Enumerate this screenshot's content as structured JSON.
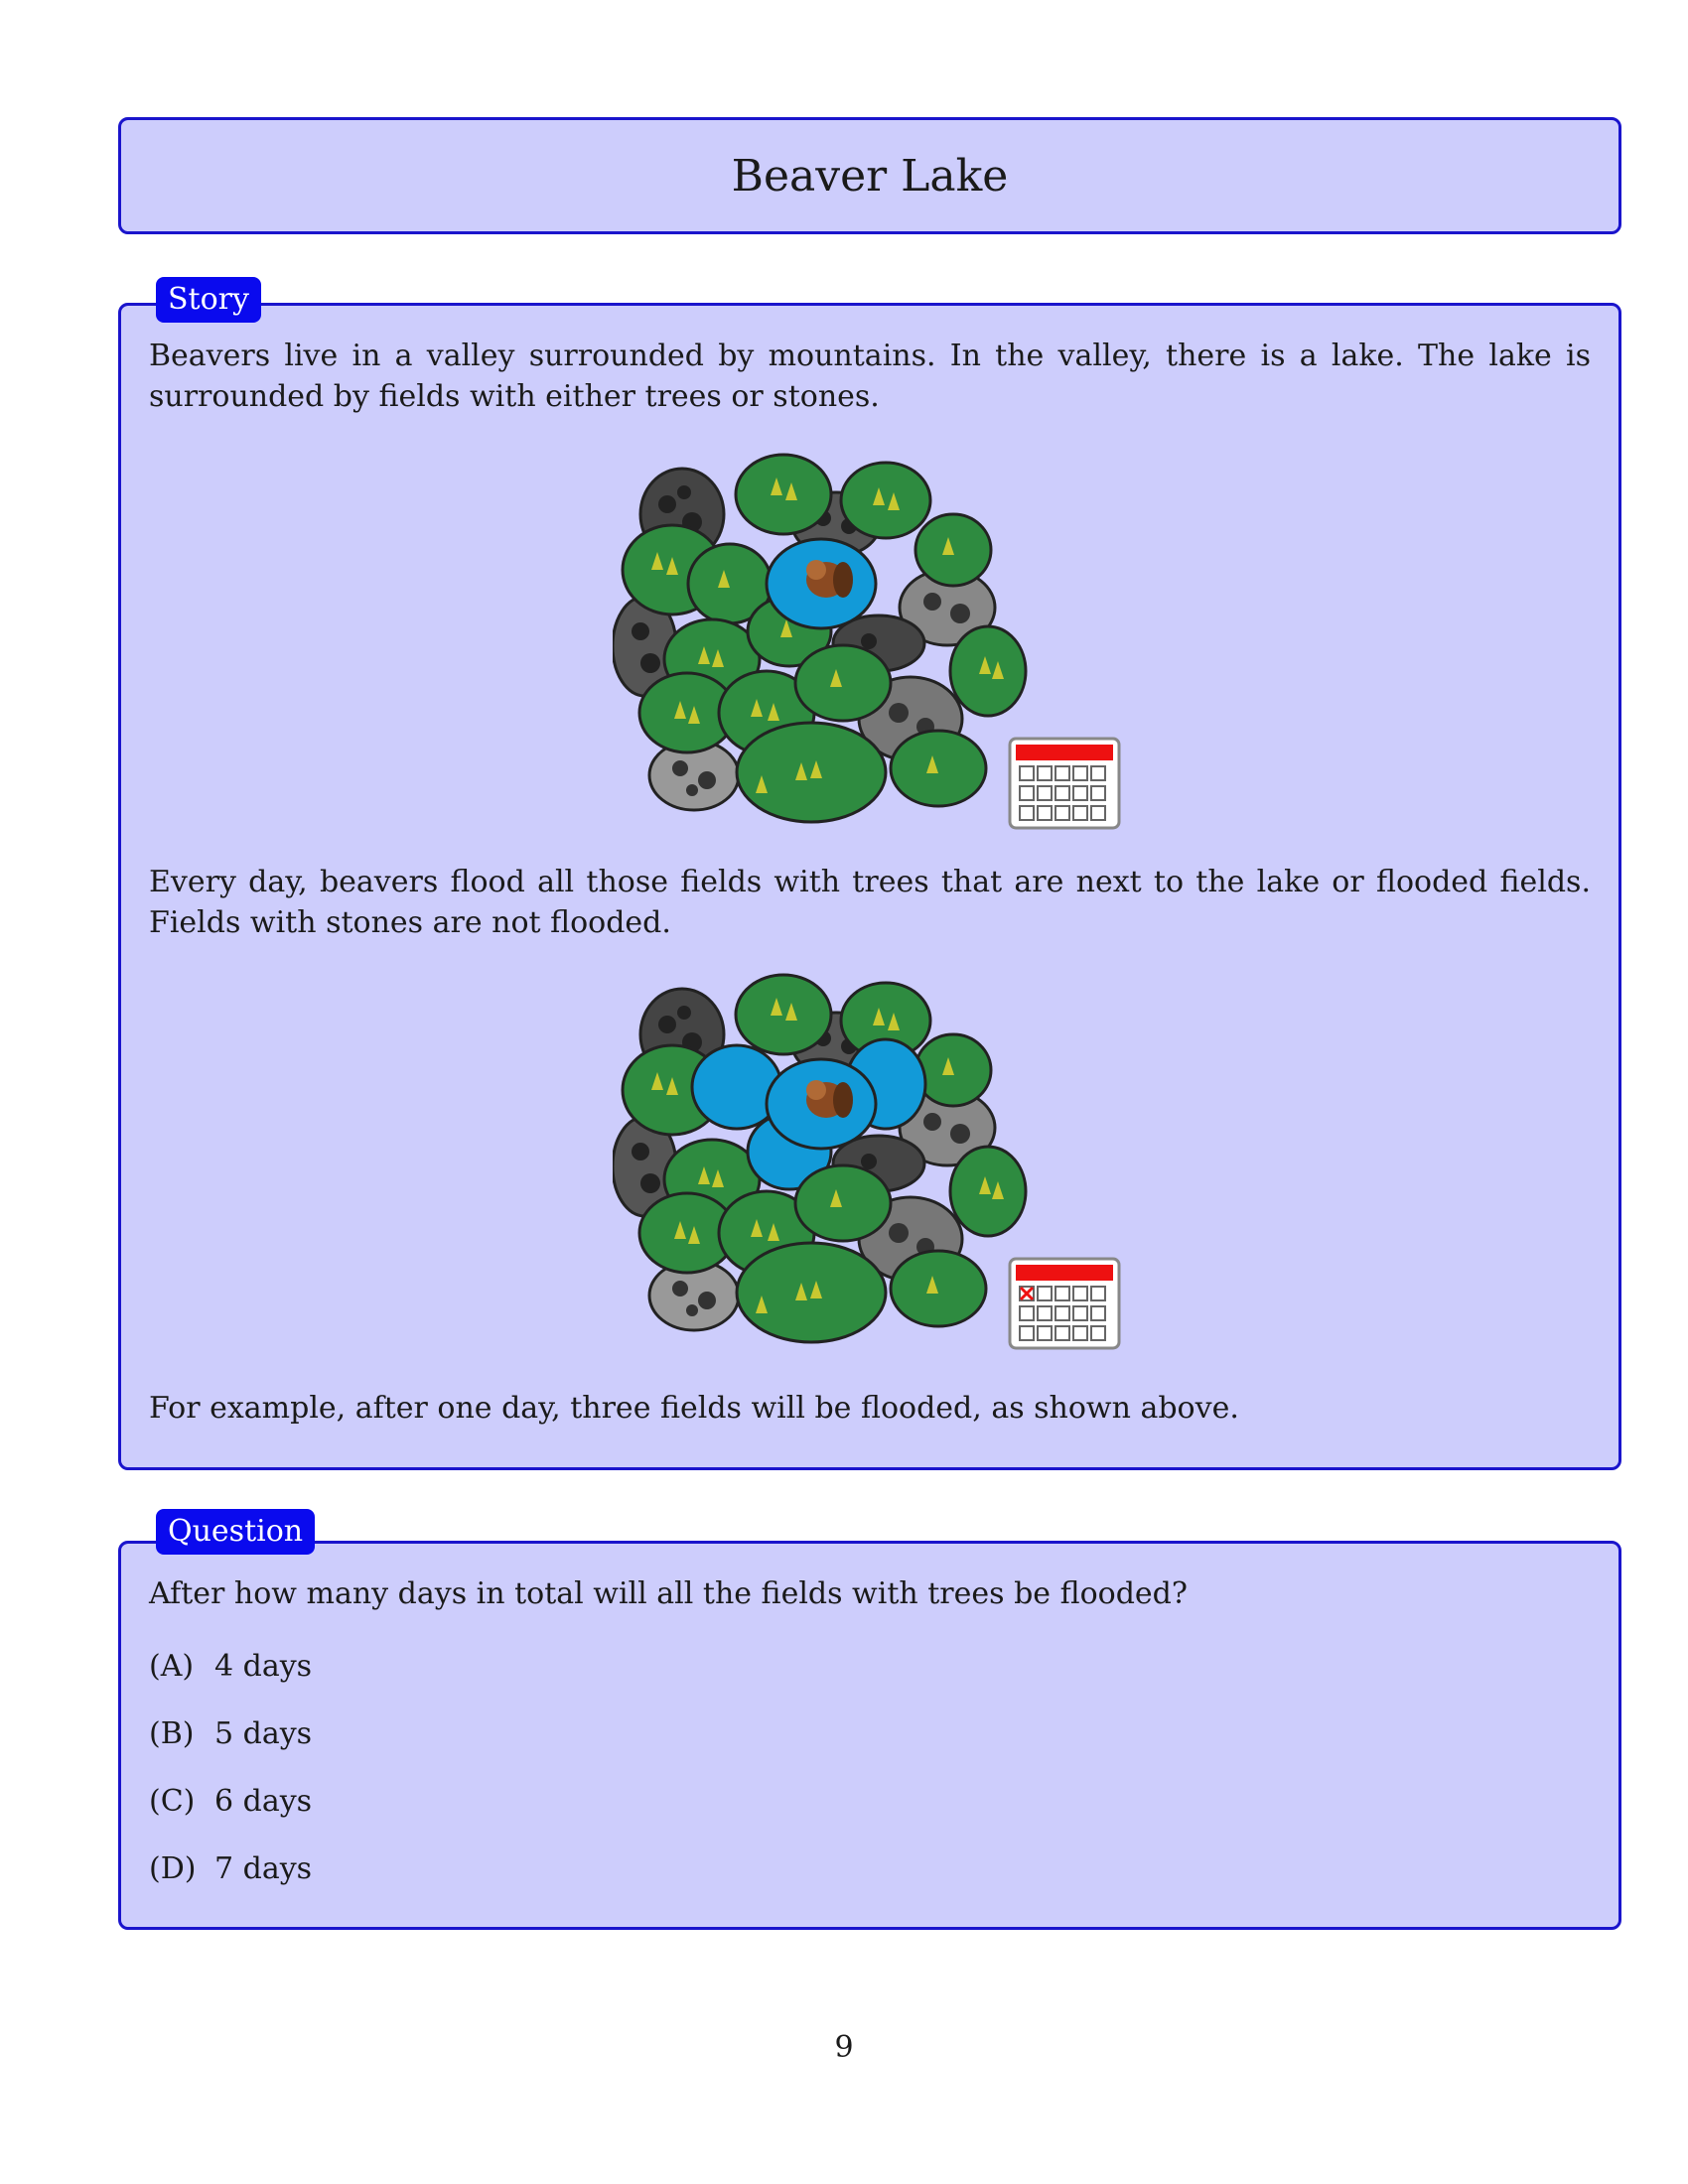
{
  "title": "Beaver Lake",
  "story": {
    "tag": "Story",
    "paragraph_1": "Beavers live in a valley surrounded by mountains. In the valley, there is a lake. The lake is surrounded by fields with either trees or stones.",
    "paragraph_2": "Every day, beavers flood all those fields with trees that are next to the lake or flooded fields. Fields with stones are not flooded.",
    "paragraph_3": "For example, after one day, three fields will be flooded, as shown above.",
    "figure_1": {
      "days_passed": 0,
      "flooded_fields": 0
    },
    "figure_2": {
      "days_passed": 1,
      "flooded_fields": 3
    }
  },
  "question": {
    "tag": "Question",
    "text": "After how many days in total will all the fields with trees be flooded?",
    "options": [
      {
        "letter": "(A)",
        "text": "4 days"
      },
      {
        "letter": "(B)",
        "text": "5 days"
      },
      {
        "letter": "(C)",
        "text": "6 days"
      },
      {
        "letter": "(D)",
        "text": "7 days"
      }
    ]
  },
  "page_number": "9",
  "colors": {
    "box_fill": "#cdcdfc",
    "box_border": "#1a14cc",
    "tag_fill": "#0a0aee",
    "tree_field": "#2e8b40",
    "stone_field_dark": "#444444",
    "stone_field_light": "#8a8a8a",
    "water": "#129ad8",
    "calendar_header": "#ee1111"
  }
}
